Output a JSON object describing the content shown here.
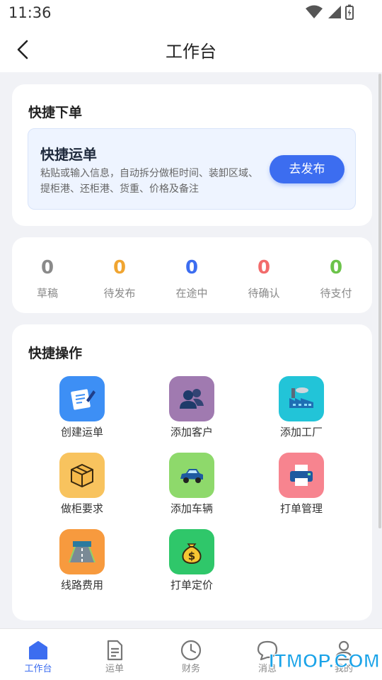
{
  "statusbar": {
    "time": "11:36"
  },
  "nav": {
    "title": "工作台"
  },
  "quick_order": {
    "section_title": "快捷下单",
    "card_title": "快捷运单",
    "description": "粘贴或输入信息，自动拆分做柜时间、装卸区域、提柜港、还柜港、货重、价格及备注",
    "publish_button": "去发布"
  },
  "stats": [
    {
      "value": "0",
      "label": "草稿",
      "color": "#8a8a8a"
    },
    {
      "value": "0",
      "label": "待发布",
      "color": "#f0a531"
    },
    {
      "value": "0",
      "label": "在途中",
      "color": "#3c6df0"
    },
    {
      "value": "0",
      "label": "待确认",
      "color": "#f26b6b"
    },
    {
      "value": "0",
      "label": "待支付",
      "color": "#6cc34a"
    }
  ],
  "quick_actions": {
    "section_title": "快捷操作",
    "items": [
      {
        "label": "创建运单",
        "icon": "create-waybill-icon",
        "bg": "#3d8ff5"
      },
      {
        "label": "添加客户",
        "icon": "add-customer-icon",
        "bg": "#a07ab0"
      },
      {
        "label": "添加工厂",
        "icon": "add-factory-icon",
        "bg": "#22c4d8"
      },
      {
        "label": "做柜要求",
        "icon": "container-requirement-icon",
        "bg": "#f8c35e"
      },
      {
        "label": "添加车辆",
        "icon": "add-vehicle-icon",
        "bg": "#8ed96b"
      },
      {
        "label": "打单管理",
        "icon": "print-management-icon",
        "bg": "#f7848f"
      },
      {
        "label": "线路费用",
        "icon": "route-cost-icon",
        "bg": "#f79a3e"
      },
      {
        "label": "打单定价",
        "icon": "print-pricing-icon",
        "bg": "#2fc76a"
      }
    ]
  },
  "tabbar": {
    "tabs": [
      {
        "label": "工作台",
        "icon": "home-icon",
        "active": true
      },
      {
        "label": "运单",
        "icon": "document-icon",
        "active": false
      },
      {
        "label": "财务",
        "icon": "clock-icon",
        "active": false
      },
      {
        "label": "消息",
        "icon": "chat-icon",
        "active": false
      },
      {
        "label": "我的",
        "icon": "user-icon",
        "active": false
      }
    ]
  },
  "watermark": "ITMOP.COM",
  "colors": {
    "accent": "#3c6df0",
    "background": "#f1f2f6"
  }
}
